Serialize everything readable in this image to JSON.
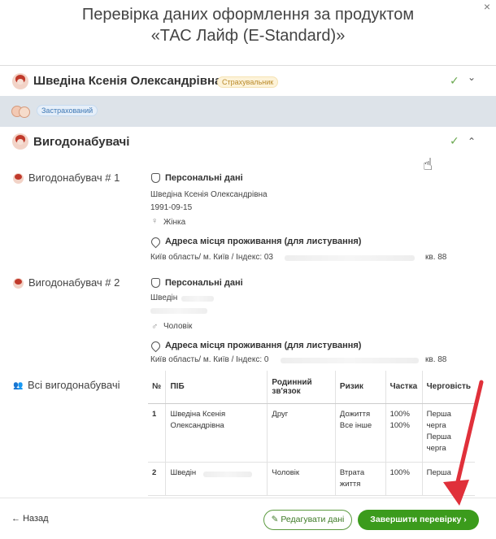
{
  "dialog": {
    "title_line1": "Перевірка даних оформлення за продуктом",
    "title_line2": "«ТАС Лайф (E-Standard)»",
    "close_glyph": "×"
  },
  "insurer": {
    "name": "Шведіна Ксенія Олександрівна",
    "role_badge": "Страхувальник",
    "check": "✓",
    "chevron": "⌄"
  },
  "insured": {
    "badge": "Застрахований"
  },
  "beneficiaries": {
    "heading": "Вигодонабувачі",
    "check": "✓",
    "chevron": "⌃",
    "items": [
      {
        "label": "Вигодонабувач # 1",
        "personal_title": "Персональні дані",
        "name": "Шведіна Ксенія Олександрівна",
        "birthdate": "1991-09-15",
        "gender_icon": "♀",
        "gender": "Жінка",
        "address_title": "Адреса місця проживання (для листування)",
        "address_start": "Київ область/ м. Київ / Індекс: 03",
        "address_end": "кв. 88"
      },
      {
        "label": "Вигодонабувач # 2",
        "personal_title": "Персональні дані",
        "name": "Шведін",
        "gender_icon": "♂",
        "gender": "Чоловік",
        "address_title": "Адреса місця проживання (для листування)",
        "address_start": "Київ область/ м. Київ / Індекс: 0",
        "address_end": "кв. 88"
      }
    ],
    "all_label": "Всі вигодонабувачі",
    "table": {
      "headers": [
        "№",
        "ПІБ",
        "Родинний зв'язок",
        "Ризик",
        "Частка",
        "Черговість"
      ],
      "rows": [
        {
          "num": "1",
          "name": "Шведіна Ксенія Олександрівна",
          "relation": "Друг",
          "risk": "Дожиття Все інше",
          "share": "100% 100%",
          "order": "Перша черга Перша черга"
        },
        {
          "num": "2",
          "name": "Шведін",
          "relation": "Чоловік",
          "risk": "Втрата життя",
          "share": "100%",
          "order": "Перша"
        }
      ]
    }
  },
  "footer": {
    "back": "Назад",
    "edit": "Редагувати дані",
    "finish": "Завершити перевірку"
  },
  "colors": {
    "accent_green": "#3b9b1c",
    "annotation_red": "#e0303a"
  }
}
